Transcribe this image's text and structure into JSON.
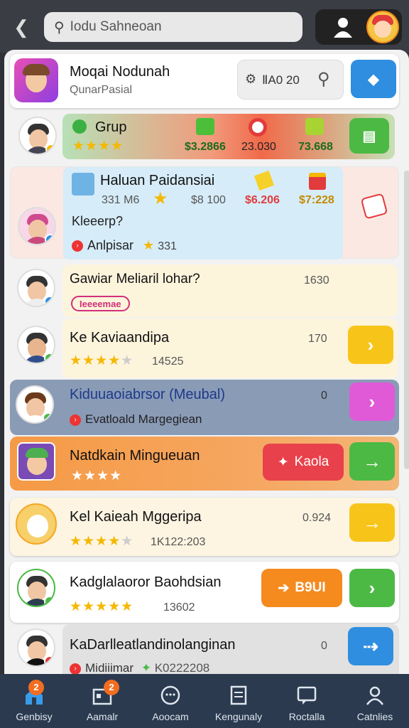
{
  "topbar": {
    "search_placeholder": "Iodu Sahneoan"
  },
  "header": {
    "title": "Moqai Nodunah",
    "subtitle": "QunarPasial",
    "filter_label": "ⅡA0 20"
  },
  "rows": [
    {
      "title": "Grup",
      "values": [
        "$3.2866",
        "23.030",
        "73.668"
      ],
      "stars": 4
    },
    {
      "title": "Haluan Paidansiai",
      "values": [
        "331 M6",
        "$8 100",
        "$6.206",
        "$7:228"
      ],
      "subtitle": "Kleeerp?",
      "tag": "Anlpisar",
      "tag_value": "331"
    },
    {
      "title": "Gawiar Meliaril lohar?",
      "value": "1630",
      "pill": "Ieeeemae"
    },
    {
      "title": "Ke Kaviaandipa",
      "value": "170",
      "stars": 4,
      "count": "14525"
    },
    {
      "title": "Kiduuaoiabrsor (Meubal)",
      "value": "0",
      "subtitle": "Evatloald Margegiean"
    },
    {
      "title": "Natdkain Mingueuan",
      "stars": 4,
      "button_label": "Kaola"
    },
    {
      "title": "Kel Kaieah Mggeripa",
      "value": "0.924",
      "stars": 4,
      "count": "1K122:203"
    },
    {
      "title": "Kadglalaoror Baohdsian",
      "stars": 5,
      "count": "13602",
      "button_label": "B9UI"
    },
    {
      "title": "KaDarlleatlandinolanginan",
      "value": "0",
      "subtitle": "Midiiimar",
      "count": "K0222208"
    }
  ],
  "bottom_nav": [
    {
      "label": "Genbisy",
      "badge": "2"
    },
    {
      "label": "Aamalr",
      "badge": "2"
    },
    {
      "label": "Aoocam",
      "badge": ""
    },
    {
      "label": "Kengunaly",
      "badge": ""
    },
    {
      "label": "Roctalla",
      "badge": ""
    },
    {
      "label": "Catnlies",
      "badge": ""
    }
  ],
  "colors": {
    "topbar": "#3a3d44",
    "bottom_nav": "#2b3a4f",
    "accent_blue": "#2f8ee0",
    "accent_green": "#49b944",
    "accent_yellow": "#f7c51a",
    "accent_pink": "#e05ad8",
    "accent_orange": "#f58a1f",
    "accent_red": "#e8414b"
  }
}
